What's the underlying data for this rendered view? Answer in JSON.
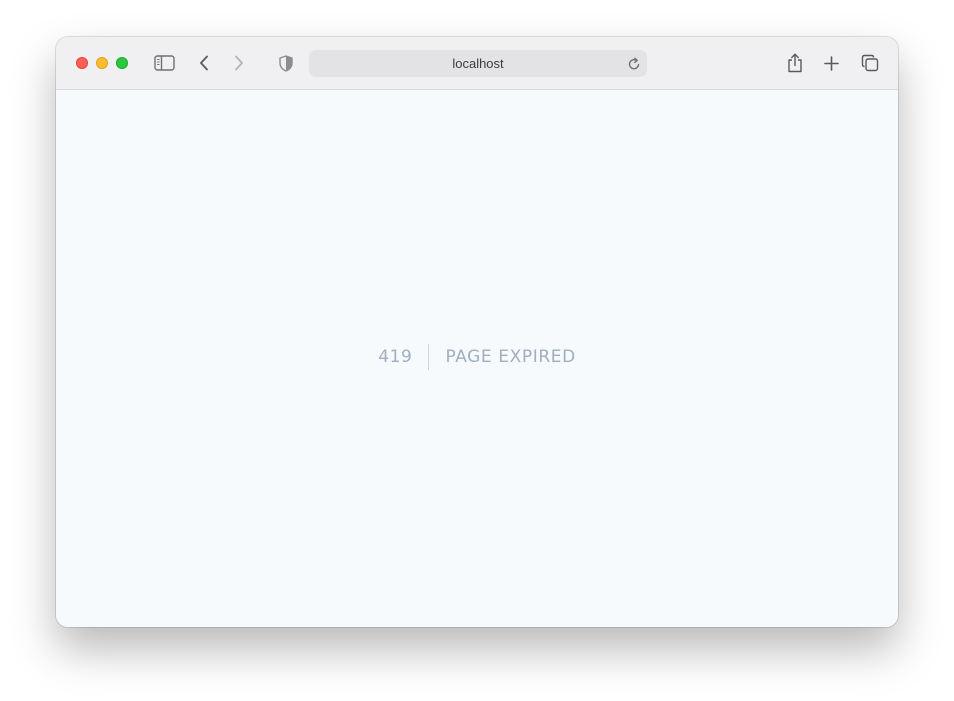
{
  "browser": {
    "address_bar": {
      "url": "localhost"
    },
    "icons": {
      "sidebar": "sidebar-icon",
      "back": "chevron-left-icon",
      "forward": "chevron-right-icon",
      "privacy": "shield-icon",
      "reload": "reload-icon",
      "share": "share-icon",
      "new_tab": "plus-icon",
      "tabs_overview": "tabs-overview-icon"
    },
    "traffic_lights": {
      "close": "#fe5f57",
      "minimize": "#febc2e",
      "maximize": "#28c840"
    }
  },
  "page": {
    "error": {
      "code": "419",
      "message": "PAGE EXPIRED"
    },
    "colors": {
      "background": "#f7fafc",
      "text": "#a0aec0",
      "divider": "#cbd5e0"
    }
  }
}
